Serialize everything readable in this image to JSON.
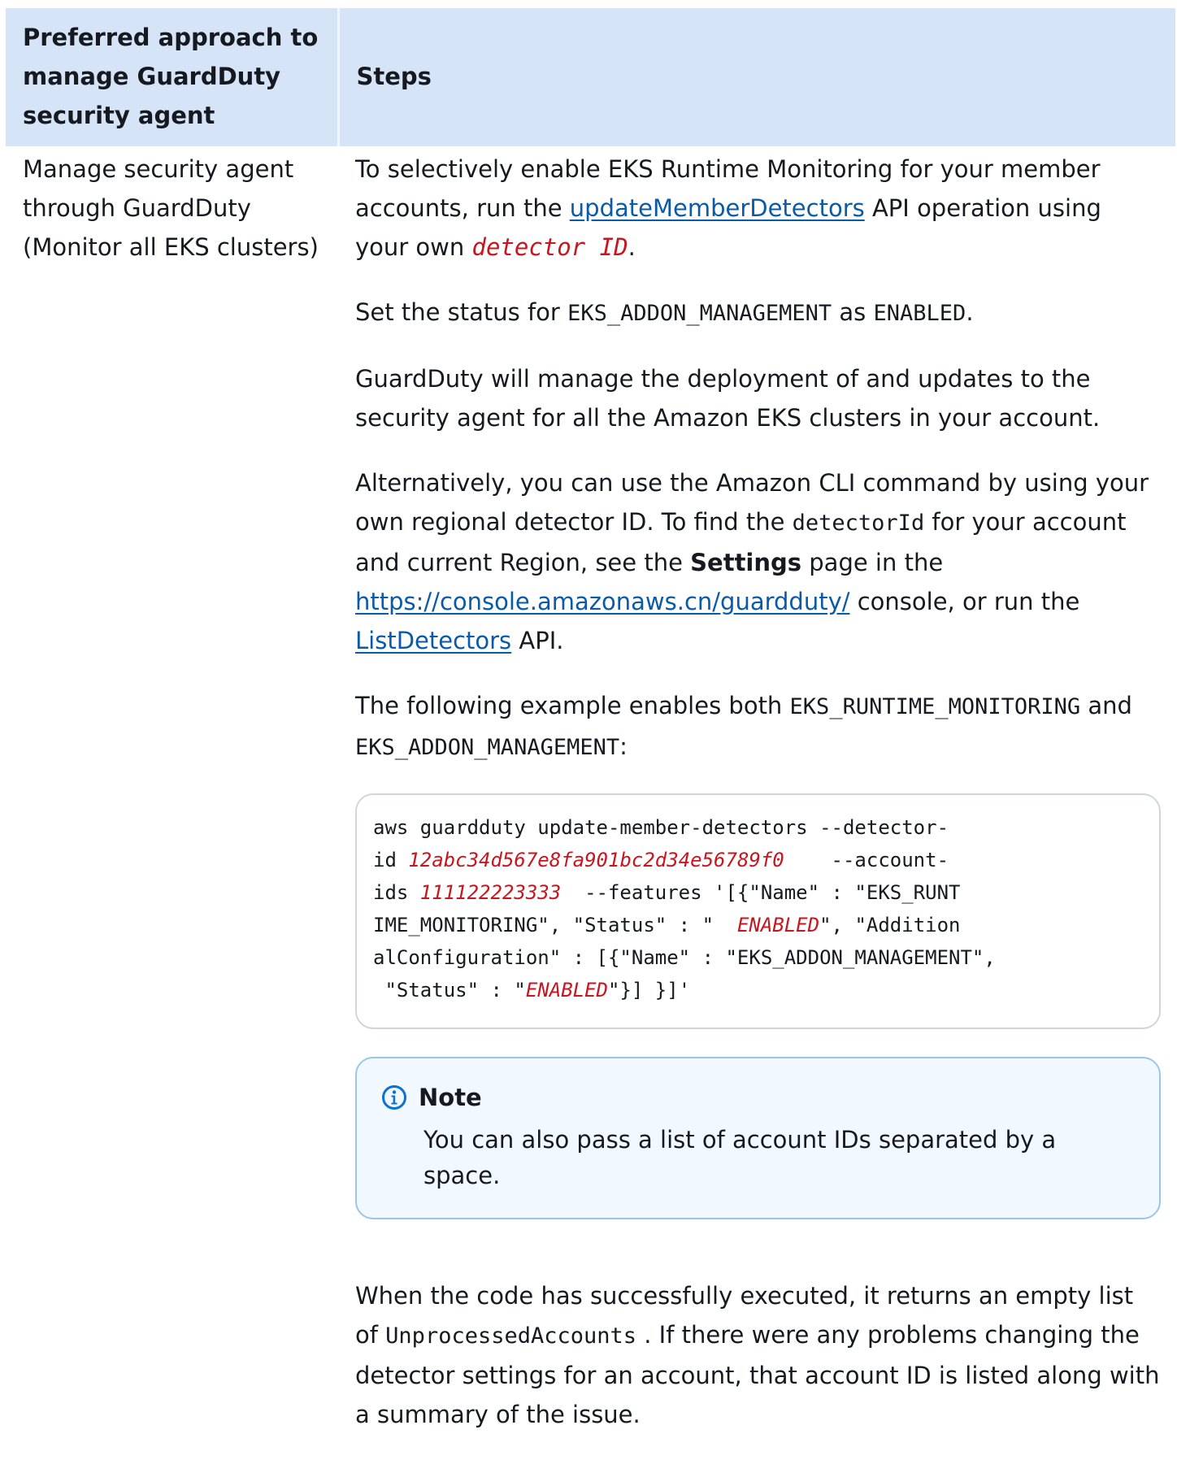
{
  "header": {
    "col1": "Preferred approach to manage GuardDuty security agent",
    "col2": "Steps"
  },
  "row": {
    "col1": "Manage security agent through GuardDuty (Monitor all EKS clusters)"
  },
  "steps": {
    "p1_a": "To selectively enable EKS Runtime Monitoring for your member accounts, run the ",
    "p1_link": "updateMemberDetectors",
    "p1_b": " API operation using your own ",
    "p1_var": "detector ID",
    "p1_c": ".",
    "p2_a": "Set the status for ",
    "p2_code": "EKS_ADDON_MANAGEMENT",
    "p2_b": " as ",
    "p2_code2": "ENABLED",
    "p2_c": ".",
    "p3": "GuardDuty will manage the deployment of and updates to the security agent for all the Amazon EKS clusters in your account.",
    "p4_a": "Alternatively, you can use the Amazon CLI command by using your own regional detector ID. To find the ",
    "p4_code": "detectorId",
    "p4_b": " for your account and current Region, see the ",
    "p4_bold": "Settings",
    "p4_c": " page in the ",
    "p4_link1": "https://console.amazonaws.cn/guardduty/",
    "p4_d": " console, or run the ",
    "p4_link2": "ListDetectors",
    "p4_e": " API.",
    "p5_a": "The following example enables both ",
    "p5_code1": "EKS_RUNTIME_MONITORING",
    "p5_b": " and ",
    "p5_code2": "EKS_ADDON_MANAGEMENT",
    "p5_c": ":",
    "code": {
      "l1": "aws guardduty update-member-detectors --detector-",
      "l2a": "id ",
      "l2v": "12abc34d567e8fa901bc2d34e56789f0",
      "l2b": "    --account-",
      "l3a": "ids ",
      "l3v": "111122223333",
      "l3b": "  --features '[{\"Name\" : \"EKS_RUNT",
      "l4a": "IME_MONITORING\", \"Status\" : \"  ",
      "l4v": "ENABLED",
      "l4b": "\", \"Addition",
      "l5": "alConfiguration\" : [{\"Name\" : \"EKS_ADDON_MANAGEMENT\",",
      "l6a": " \"Status\" : \"",
      "l6v": "ENABLED",
      "l6b": "\"}] }]'"
    },
    "note_title": "Note",
    "note_body": "You can also pass a list of account IDs separated by a space.",
    "p6_a": "When the code has successfully executed, it returns an empty list of ",
    "p6_code": "UnprocessedAccounts",
    "p6_b": " . If there were any problems changing the detector settings for an account, that account ID is listed along with a summary of the issue."
  },
  "colors": {
    "header_bg": "#d5e5f7",
    "link": "#0a5aaa",
    "variable": "#c7161f",
    "note_border": "#9ac6e8",
    "note_bg": "#f1f8ff",
    "info_icon": "#0972d3"
  },
  "icons": {
    "note": "info-circle-icon"
  }
}
